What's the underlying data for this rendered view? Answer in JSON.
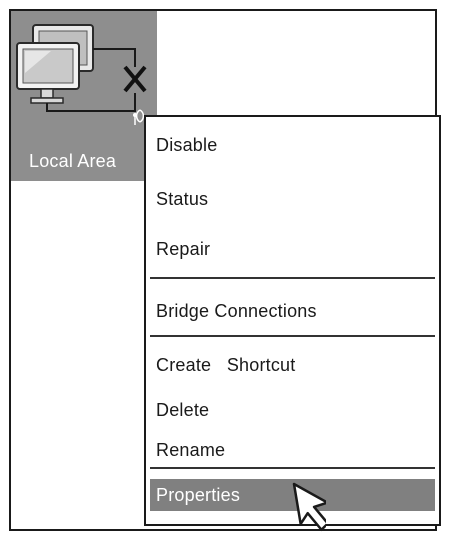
{
  "connection": {
    "label": "Local Area",
    "icon": "network-disconnected-icon",
    "status_icon": "wireless-antenna-icon"
  },
  "context_menu": {
    "items": [
      {
        "label": "Disable"
      },
      {
        "label": "Status"
      },
      {
        "label": "Repair"
      },
      {
        "label": "Bridge Connections"
      },
      {
        "label": "Create   Shortcut"
      },
      {
        "label": "Delete"
      },
      {
        "label": "Rename"
      },
      {
        "label": "Properties",
        "highlighted": true
      }
    ]
  },
  "colors": {
    "tile_background": "#8e8e8e",
    "highlight": "#808080",
    "border": "#1a1a1a"
  },
  "cursor": {
    "icon": "mouse-pointer-arrow-icon"
  }
}
